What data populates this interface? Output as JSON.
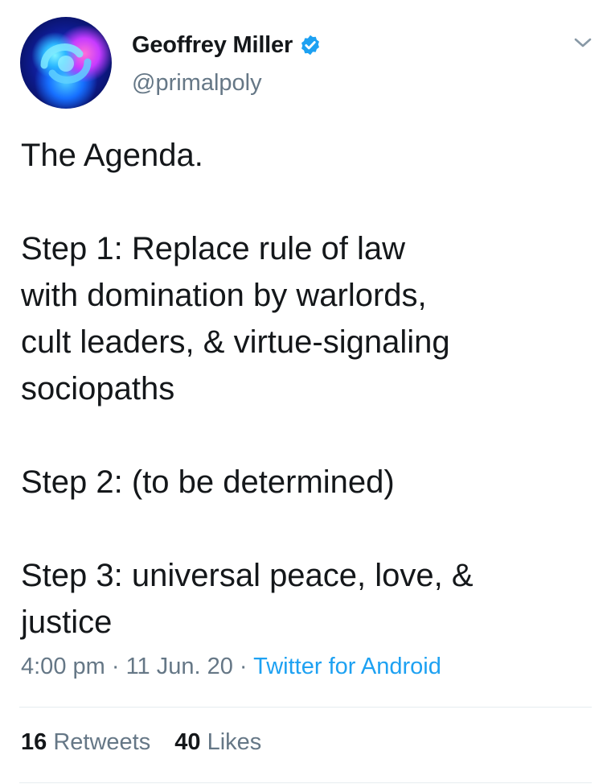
{
  "author": {
    "name": "Geoffrey Miller",
    "handle": "@primalpoly",
    "verified": true
  },
  "tweet": {
    "lines": [
      "The Agenda.",
      "",
      "Step 1: Replace rule of law",
      "with domination by warlords,",
      "cult leaders, & virtue-signaling",
      "sociopaths",
      "",
      "Step 2: (to be determined)",
      "",
      "Step 3: universal peace, love, &",
      "justice"
    ],
    "time": "4:00 pm",
    "separator1": " · ",
    "date": "11 Jun. 20",
    "separator2": " · ",
    "source": "Twitter for Android"
  },
  "stats": {
    "retweets_count": "16",
    "retweets_label": "Retweets",
    "likes_count": "40",
    "likes_label": "Likes"
  },
  "colors": {
    "text": "#14171a",
    "secondary": "#657786",
    "accent": "#1da1f2",
    "divider": "#e6ecf0"
  },
  "icons": {
    "verified": "verified-badge-icon",
    "caret": "chevron-down-icon"
  }
}
